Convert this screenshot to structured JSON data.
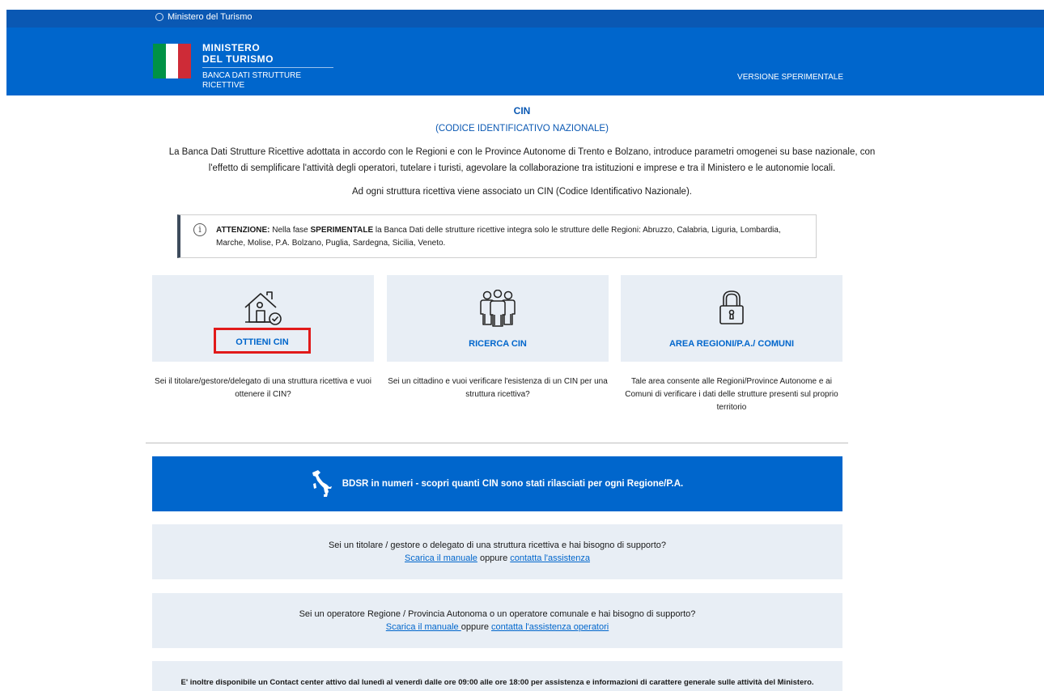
{
  "topbar": {
    "ministry": "Ministero del Turismo"
  },
  "header": {
    "logo_line1": "MINISTERO",
    "logo_line2": "DEL TURISMO",
    "subtitle": "BANCA DATI STRUTTURE RICETTIVE",
    "version": "VERSIONE SPERIMENTALE",
    "flag_colors": [
      "#009246",
      "#ffffff",
      "#ce2b37"
    ]
  },
  "intro": {
    "title": "CIN",
    "subtitle": "(CODICE IDENTIFICATIVO NAZIONALE)",
    "desc_line1": "La Banca Dati Strutture Ricettive adottata in accordo con le Regioni e con le Province Autonome di Trento e Bolzano, introduce parametri omogenei su base nazionale, con",
    "desc_line2": "l'effetto di semplificare l'attività degli operatori, tutelare i turisti, agevolare la collaborazione tra istituzioni e imprese e tra il Ministero e le autonomie locali.",
    "assoc": "Ad ogni struttura ricettiva viene associato un CIN (Codice Identificativo Nazionale)."
  },
  "notice": {
    "icon": "info-icon",
    "label": "ATTENZIONE:",
    "t1": " Nella fase ",
    "emph": "SPERIMENTALE",
    "t2": " la Banca Dati delle strutture ricettive integra solo le strutture delle Regioni: Abruzzo, Calabria, Liguria, Lombardia, Marche, Molise, P.A. Bolzano, Puglia, Sardegna, Sicilia, Veneto."
  },
  "cards": [
    {
      "label": "OTTIENI CIN",
      "icon": "house-check-icon",
      "desc": "Sei il titolare/gestore/delegato di una struttura ricettiva e vuoi ottenere il CIN?"
    },
    {
      "label": "RICERCA CIN",
      "icon": "people-group-icon",
      "desc": "Sei un cittadino e vuoi verificare l'esistenza di un CIN per una struttura ricettiva?"
    },
    {
      "label": "AREA REGIONI/P.A./ COMUNI",
      "icon": "padlock-icon",
      "desc": "Tale area consente alle Regioni/Province Autonome e ai Comuni di verificare i dati delle strutture presenti sul proprio territorio"
    }
  ],
  "bdsr": {
    "label": "BDSR in numeri - scopri quanti CIN sono stati rilasciati per ogni Regione/P.A.",
    "icon": "italy-map-icon"
  },
  "support1": {
    "question": "Sei un titolare / gestore o delegato di una struttura ricettiva e hai bisogno di supporto?",
    "manual_link": "Scarica il manuale",
    "or": " oppure ",
    "assist_link": "contatta l'assistenza"
  },
  "support2": {
    "question": "Sei un operatore Regione / Provincia Autonoma o un operatore comunale e hai bisogno di supporto?",
    "manual_link": "Scarica il manuale ",
    "or": "oppure ",
    "assist_link": "contatta l'assistenza operatori"
  },
  "contact": {
    "text": "E' inoltre disponibile un Contact center attivo dal lunedì al venerdì dalle ore 09:00 alle ore 18:00 per assistenza e informazioni di carattere generale sulle attività del Ministero."
  },
  "colors": {
    "brand_blue": "#0066cc",
    "topbar_blue": "#0a58b3",
    "card_bg": "#e8eef5",
    "highlight_red": "#e11a1a"
  }
}
